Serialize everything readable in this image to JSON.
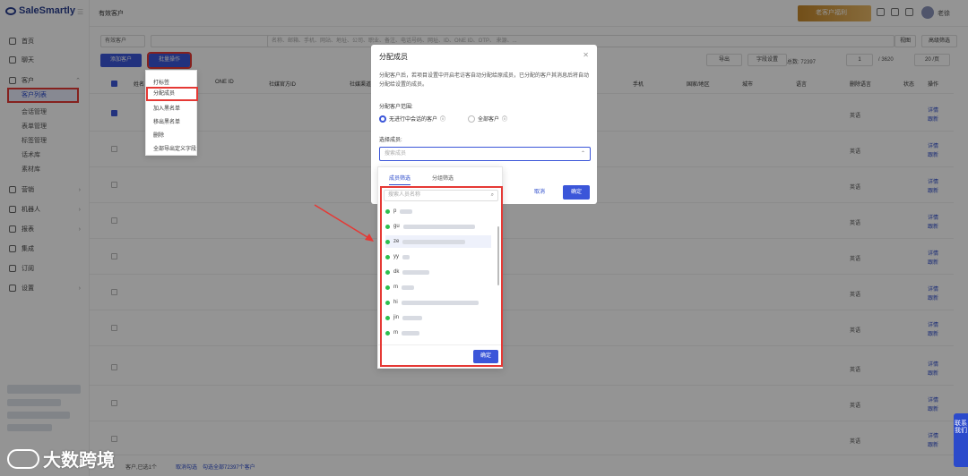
{
  "app": {
    "brand": "SaleSmartly"
  },
  "sidebar": {
    "items": [
      {
        "label": "首页",
        "icon": "home-icon"
      },
      {
        "label": "聊天",
        "icon": "chat-icon"
      },
      {
        "label": "客户",
        "icon": "customer-icon"
      },
      {
        "label": "营销",
        "icon": "marketing-icon"
      },
      {
        "label": "机器人",
        "icon": "robot-icon"
      },
      {
        "label": "报表",
        "icon": "report-icon"
      },
      {
        "label": "集成",
        "icon": "integration-icon"
      },
      {
        "label": "订阅",
        "icon": "subscription-icon"
      },
      {
        "label": "设置",
        "icon": "settings-icon"
      }
    ],
    "customer_sub": [
      "客户列表",
      "会话管理",
      "表单管理",
      "标签管理",
      "话术库",
      "素材库"
    ]
  },
  "header": {
    "breadcrumb": "有效客户",
    "user": "老徐"
  },
  "toolbar": {
    "filter_select": "有效客户",
    "add_button": "添加客户",
    "batch_button": "批量操作",
    "export_button": "导出",
    "field_settings": "字段设置",
    "total": "总数: 72397",
    "page_current": "1",
    "page_total": "/ 3620",
    "page_size": "20 /页",
    "view_button": "视图",
    "advanced_filter": "高级筛选",
    "keyword_placeholder": "名称、邮箱、手机、网站、地址、公司、职业、备注、电话号码、网址、ID、ONE ID、OTP、 来源、..."
  },
  "table": {
    "headers": [
      "姓名",
      "ONE ID",
      "社媒官方ID",
      "社媒渠道",
      "手机",
      "国家/地区",
      "城市",
      "语言",
      "删除语言",
      "状态",
      "操作"
    ],
    "lang_value": "英语",
    "action_detail": "详情",
    "action_follow": "跟新"
  },
  "batch_menu": [
    "打标签",
    "分配成员",
    "加入黑名单",
    "移出黑名单",
    "删除",
    "全部导出定义字段"
  ],
  "modal": {
    "title": "分配成员",
    "description": "分配客户后，若项目设置中开启老访客自动分配给原成员，已分配的客户其消息后将自动分配给设置的成员。",
    "scope_label": "分配客户范围:",
    "scope_options": [
      "无进行中会话的客户",
      "全部客户"
    ],
    "member_label": "选择成员:",
    "member_placeholder": "搜索成员",
    "cancel": "取消",
    "ok": "确定"
  },
  "member_panel": {
    "tabs": [
      "成员筛选",
      "分组筛选"
    ],
    "search_placeholder": "搜索人员名称",
    "members": [
      "p",
      "gu",
      "ze",
      "yy",
      "dk",
      "m",
      "hi",
      "jin",
      "m"
    ],
    "ok": "确定"
  },
  "footer": {
    "selected_text": "客户,已选1个",
    "cancel_select": "取消勾选",
    "select_all": "勾选全部72397个客户"
  },
  "watermark": "大数跨境",
  "contact_tab": "联系我们",
  "promo": "老客户福利"
}
